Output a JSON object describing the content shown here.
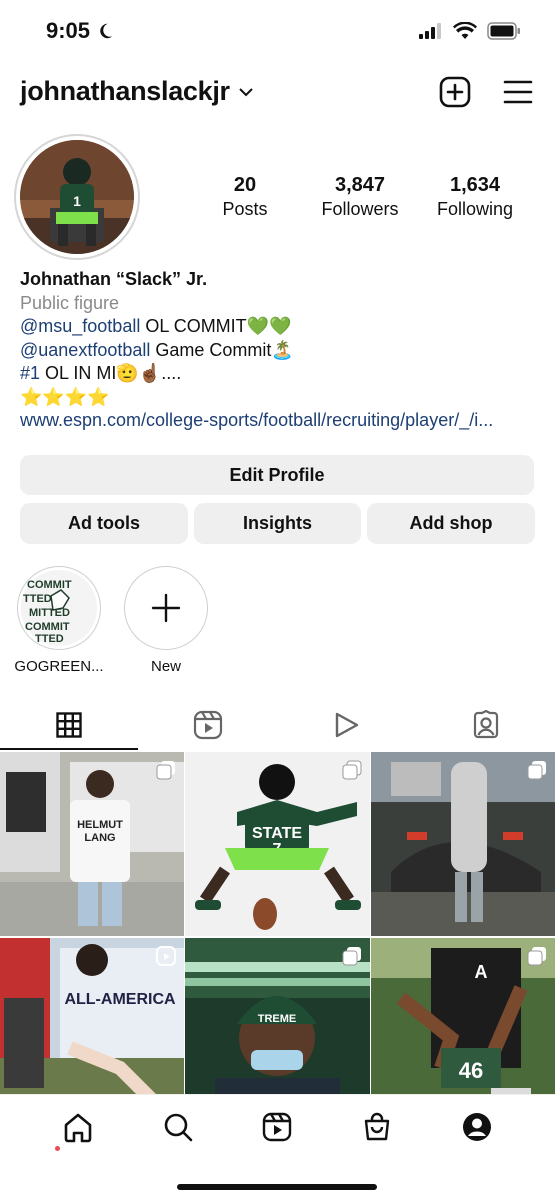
{
  "status_bar": {
    "time": "9:05"
  },
  "header": {
    "username": "johnathanslackjr"
  },
  "profile": {
    "stats": [
      {
        "value": "20",
        "label": "Posts"
      },
      {
        "value": "3,847",
        "label": "Followers"
      },
      {
        "value": "1,634",
        "label": "Following"
      }
    ],
    "bio": {
      "name": "Johnathan “Slack” Jr.",
      "category": "Public figure",
      "line1_mention": "@msu_football",
      "line1_text": " OL COMMIT💚💚",
      "line2_mention": "@uanextfootball",
      "line2_text": " Game Commit🏝️",
      "line3_hashtag": "#1",
      "line3_text": " OL IN MI🫡☝🏾....",
      "line4": "⭐⭐⭐⭐",
      "url": "www.espn.com/college-sports/football/recruiting/player/_/i..."
    }
  },
  "buttons": {
    "edit_profile": "Edit Profile",
    "ad_tools": "Ad tools",
    "insights": "Insights",
    "add_shop": "Add shop"
  },
  "highlights": [
    {
      "label": "GOGREEN..."
    },
    {
      "label": "New"
    }
  ],
  "tabs": [
    "grid-icon",
    "reels-icon",
    "play-icon",
    "tagged-icon"
  ],
  "colors": {
    "accent_link": "#1d3f74",
    "button_bg": "#efefef",
    "notification_dot": "#ed4956"
  }
}
